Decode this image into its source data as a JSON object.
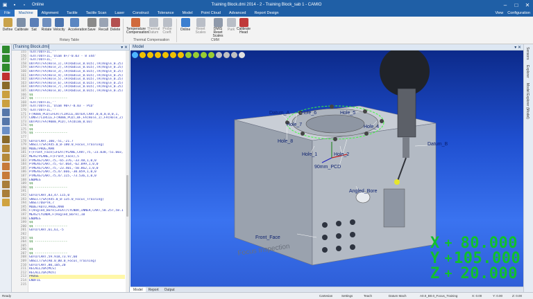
{
  "titlebar": {
    "online": "Online",
    "title": "Training Block.dmi  2014 - 2 - Training Block_sab 1 - CAMIO"
  },
  "ribbon_tabs": [
    "File",
    "Machine",
    "Alignment",
    "Tactile",
    "Tactile Scan",
    "Laser",
    "Construct",
    "Tolerance",
    "Model",
    "Point Cloud",
    "Advanced",
    "Report Design"
  ],
  "ribbon_right": {
    "view": "View",
    "configuration": "Configuration"
  },
  "ribbon": {
    "buttons": [
      "Define",
      "Calibrate",
      "Sat",
      "Rotate",
      "Velocity",
      "Acceleration",
      "Save",
      "Recall",
      "Delete",
      "Temperature Compensation",
      "Thermal Datum",
      "Probe Coeff.",
      "Online",
      "Reset Scales",
      "DMIS Reset Scales",
      "Park",
      "Calibrate Head"
    ],
    "groups": {
      "rotary": "Rotary Table",
      "thermal": "Thermal Compensation",
      "cmm": "CMM"
    }
  },
  "editor": {
    "title": "[Training Block.dmi]",
    "line_numbers": [
      155,
      156,
      157,
      158,
      159,
      160,
      161,
      162,
      163,
      164,
      165,
      166,
      167,
      168,
      169,
      170,
      171,
      172,
      173,
      174,
      175,
      176,
      177,
      178,
      179,
      180,
      181,
      182,
      183,
      184,
      185,
      186,
      187,
      188,
      189,
      190,
      191,
      192,
      193,
      194,
      195,
      196,
      197,
      198,
      199,
      200,
      201,
      202,
      203,
      204,
      205,
      206,
      207,
      208,
      209,
      210,
      211,
      212,
      213,
      214,
      215
    ],
    "lines": [
      {
        "t": "TEXT/OUTFIL,''",
        "c": "kw"
      },
      {
        "t": "TEXT/OUTFIL,'Diam 8+/-0.03 - 8 x44'",
        "c": "kw"
      },
      {
        "t": "TEXT/OUTFIL,''",
        "c": "kw"
      },
      {
        "t": "OUTPUT/FA(Hole_1),TA(Radius_0.015),TA(Angle_0.25)",
        "c": "kw"
      },
      {
        "t": "OUTPUT/FA(Hole_2),TA(Radius_0.015),TA(Angle_0.25)",
        "c": "kw"
      },
      {
        "t": "OUTPUT/FA(Hole_3),TA(Radius_0.015),TA(Angle_0.25)",
        "c": "kw"
      },
      {
        "t": "OUTPUT/FA(Hole_4),TA(Radius_0.015),TA(Angle_0.25)",
        "c": "kw"
      },
      {
        "t": "OUTPUT/FA(Hole_5),TA(Radius_0.015),TA(Angle_0.25)",
        "c": "kw"
      },
      {
        "t": "OUTPUT/FA(Hole_6),TA(Radius_0.015),TA(Angle_0.25)",
        "c": "kw"
      },
      {
        "t": "OUTPUT/FA(Hole_7),TA(Radius_0.015),TA(Angle_0.25)",
        "c": "kw"
      },
      {
        "t": "OUTPUT/FA(Hole_8),TA(Radius_0.015),TA(Angle_0.25)",
        "c": "kw"
      },
      {
        "t": "$$",
        "c": "cm"
      },
      {
        "t": "$$ -----------------",
        "c": "cm"
      },
      {
        "t": "TEXT/OUTFIL,''",
        "c": "kw"
      },
      {
        "t": "TEXT/OUTFIL,'Diam 90+/-0.03 - PCD'",
        "c": "kw"
      },
      {
        "t": "TEXT/OUTFIL,''",
        "c": "kw"
      },
      {
        "t": "F(90mm_PCD)=FEAT/CIRCLE,OUTER,CART,0,0,0,0,0,1,",
        "c": "kw"
      },
      {
        "t": "CONST/CIRCLE,F(90mm_PCD),BF,FA(Hole_1),FA(Hole_2)",
        "c": "kw"
      },
      {
        "t": "OUTPUT/FA(90mm_PCD),TA(Diam_0.03)",
        "c": "kw"
      },
      {
        "t": "$$",
        "c": "cm"
      },
      {
        "t": "$$",
        "c": "cm"
      },
      {
        "t": "$$ -----------------",
        "c": "cm"
      },
      {
        "t": "",
        "c": ""
      },
      {
        "t": "GOTO/CART,100,-51,-21.7",
        "c": "kw"
      },
      {
        "t": "SNSLCT/SA(A45.0_B-180.0_Focus_Training)",
        "c": "kw"
      },
      {
        "t": "MODE/PROG,MAN",
        "c": "kw"
      },
      {
        "t": "F(Front_Face)=FEAT/PLANE,CART,75,-23.038,-51.603,",
        "c": "kw"
      },
      {
        "t": "MEAS/PLANE,F(Front_Face),5",
        "c": "kw"
      },
      {
        "t": "PTMEAS/CART,75,-65.376,-33.48,1,0,0",
        "c": "kw"
      },
      {
        "t": "PTMEAS/CART,75,-67.064,-62.099,1,0,0",
        "c": "kw"
      },
      {
        "t": "PTMEAS/CART,75,-23.401,-50.862,1,0,0",
        "c": "kw"
      },
      {
        "t": "PTMEAS/CART,75,47.666,-30.059,1,0,0",
        "c": "kw"
      },
      {
        "t": "PTMEAS/CART,75,47.115,-73.536,1,0,0",
        "c": "kw"
      },
      {
        "t": "ENDMES",
        "c": "kw"
      },
      {
        "t": "$$",
        "c": "cm"
      },
      {
        "t": "$$ -----------------",
        "c": "cm"
      },
      {
        "t": "",
        "c": ""
      },
      {
        "t": "GOTO/CART,83,47.115,0",
        "c": "kw"
      },
      {
        "t": "SNSLCT/SA(A45.0_B-135.0_Focus_Training)",
        "c": "kw"
      },
      {
        "t": "SNSET/DEPTH,7",
        "c": "kw"
      },
      {
        "t": "MODE/AUTO,PROG,MAN",
        "c": "kw"
      },
      {
        "t": "F(Angled_Bore)=FEAT/CYLNDR,INNER,CART,58.257,58.1",
        "c": "kw"
      },
      {
        "t": "MEAS/CYLNDR,F(Angled_Bore),10",
        "c": "kw"
      },
      {
        "t": "ENDMES",
        "c": "kw"
      },
      {
        "t": "$$",
        "c": "cm"
      },
      {
        "t": "$$ -----------------",
        "c": "cm"
      },
      {
        "t": "GOTO/CART,61,61,-5",
        "c": "kw"
      },
      {
        "t": "",
        "c": ""
      },
      {
        "t": "$$",
        "c": "cm"
      },
      {
        "t": "$$ -----------------",
        "c": "cm"
      },
      {
        "t": "",
        "c": ""
      },
      {
        "t": "$$",
        "c": "cm"
      },
      {
        "t": "$$ -----------------",
        "c": "cm"
      },
      {
        "t": "GOTO/CART,59.918,73.97,60",
        "c": "kw"
      },
      {
        "t": "SNSLCT/SA(A0.0_B0.0_Focus_Training)",
        "c": "kw"
      },
      {
        "t": "GOTO/CART,80,105,20",
        "c": "kw"
      },
      {
        "t": "RECALL/DA(MCS)",
        "c": "kw"
      },
      {
        "t": "RECALL/DA(Mch)",
        "c": "kw"
      },
      {
        "t": "PAUSE",
        "c": "hl"
      },
      {
        "t": "ENDFIL",
        "c": "kw"
      },
      {
        "t": "",
        "c": ""
      }
    ]
  },
  "model": {
    "title": "Model",
    "labels": [
      "Datum_A",
      "Hole_6",
      "Hole_5",
      "Hole_7",
      "Hole_4",
      "Datum_B",
      "Hole_8",
      "Hole_1",
      "Hole_2",
      "90mm_PCD",
      "Angled_Bore",
      "Front_Face"
    ],
    "engraving": "Focus Inspection",
    "dro": [
      {
        "axis": "X",
        "sign": "+",
        "value": "80.000"
      },
      {
        "axis": "Y",
        "sign": "+",
        "value": "105.000"
      },
      {
        "axis": "Z",
        "sign": "+",
        "value": "20.000"
      }
    ]
  },
  "bottom_tabs": [
    "Model",
    "Report",
    "Output"
  ],
  "side_tabs": [
    "Sensors",
    "Explorer",
    "Model Explorer (Model)"
  ],
  "status": {
    "ready": "Ready",
    "items": [
      "Cartesian",
      "Settings",
      "Teach",
      "Datum Mach",
      "A0.0_B0.0_Focus_Training",
      "X: 0.00",
      "Y: 0.00",
      "Z: 0.00"
    ]
  },
  "colors": {
    "titlebar": "#1f5fa6",
    "dro_green": "#11c02d",
    "viewport_top": "#0c2a8a",
    "viewport_bottom": "#3a73f0"
  }
}
